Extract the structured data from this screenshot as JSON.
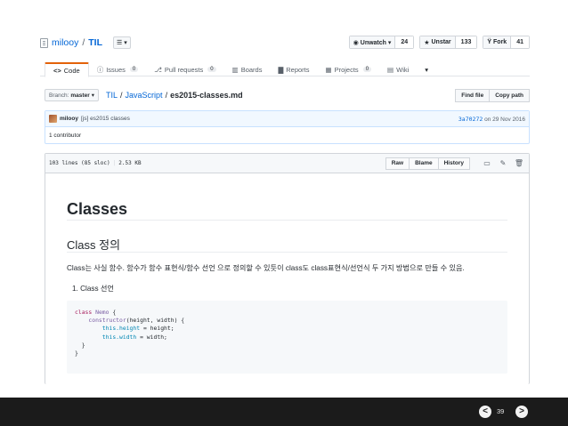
{
  "repo": {
    "owner": "milooy",
    "separator": "/",
    "name": "TIL",
    "list_icon": "list-icon",
    "list_caret": "▾"
  },
  "actions": {
    "watch": {
      "label": "Unwatch ▾",
      "count": "24"
    },
    "star": {
      "label": "Unstar",
      "count": "133"
    },
    "fork": {
      "label": "Fork",
      "count": "41"
    }
  },
  "tabs": [
    {
      "label": "Code",
      "icon": "<>"
    },
    {
      "label": "Issues",
      "count": "0"
    },
    {
      "label": "Pull requests",
      "count": "0"
    },
    {
      "label": "Boards"
    },
    {
      "label": "Reports"
    },
    {
      "label": "Projects",
      "count": "0"
    },
    {
      "label": "Wiki"
    },
    {
      "label": "▾"
    }
  ],
  "file_nav": {
    "branch_prefix": "Branch:",
    "branch": "master",
    "caret": "▾",
    "crumbs": [
      "TIL",
      "/",
      "JavaScript",
      "/",
      "es2015-classes.md"
    ],
    "find_file": "Find file",
    "copy_path": "Copy path"
  },
  "commit": {
    "user": "milooy",
    "message": "[js] es2015 classes",
    "sha": "3a70272",
    "date_text": " on 29 Nov 2016",
    "contributors": "1 contributor"
  },
  "file": {
    "lines": "103 lines (85 sloc)",
    "size": "2.53 KB",
    "raw": "Raw",
    "blame": "Blame",
    "history": "History"
  },
  "content": {
    "h1": "Classes",
    "h2": "Class 정의",
    "paragraph": "Class는 사실 함수. 함수가 함수 표현식/함수 선언 으로 정의할 수 있듯이 class도 class표현식/선언식 두 가지 방법으로 만들 수 있음.",
    "list_item": "1. Class 선언",
    "code": {
      "l1_kw": "class",
      "l1_name": "Nemo",
      "l1_rest": " {",
      "l2_fn": "constructor",
      "l2_rest": "(height, width) {",
      "l3_this": "this",
      "l3_prop": ".height",
      "l3_rest": " = height;",
      "l4_this": "this",
      "l4_prop": ".width",
      "l4_rest": " = width;",
      "l5": "  }",
      "l6": "}"
    }
  },
  "slide": {
    "page": "39",
    "prev": "<",
    "next": ">"
  }
}
